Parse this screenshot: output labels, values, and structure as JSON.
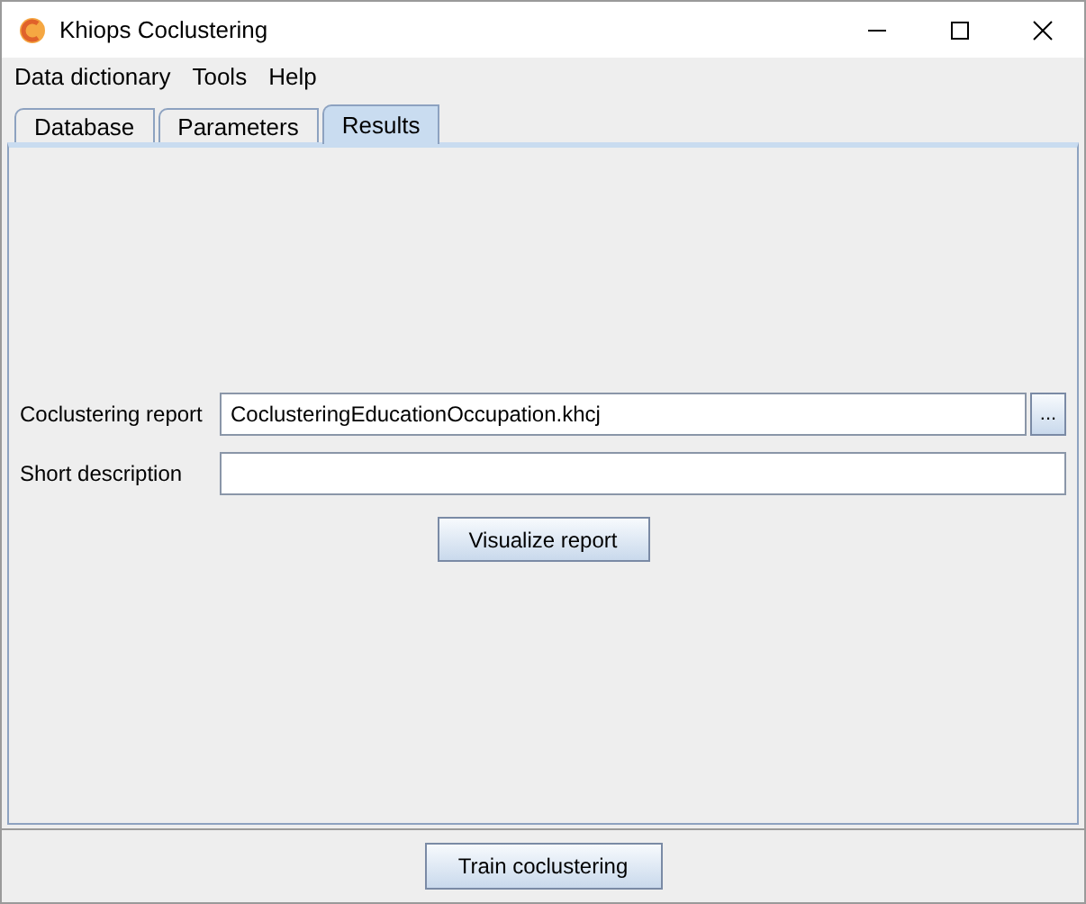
{
  "window": {
    "title": "Khiops Coclustering"
  },
  "menu": [
    "Data dictionary",
    "Tools",
    "Help"
  ],
  "tabs": [
    {
      "label": "Database",
      "selected": false
    },
    {
      "label": "Parameters",
      "selected": false
    },
    {
      "label": "Results",
      "selected": true
    }
  ],
  "fields": [
    {
      "label": "Coclustering report",
      "value": "CoclusteringEducationOccupation.khcj",
      "browse": "..."
    },
    {
      "label": "Short description"
    }
  ],
  "visualize_button": "Visualize report",
  "train_button": "Train coclustering"
}
